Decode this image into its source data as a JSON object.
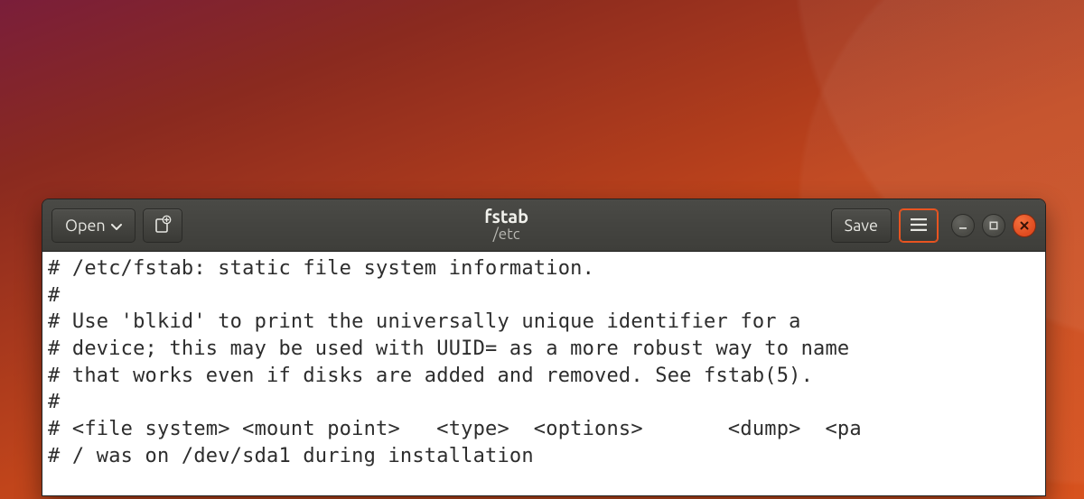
{
  "header": {
    "open_label": "Open",
    "save_label": "Save",
    "title": "fstab",
    "subtitle": "/etc"
  },
  "editor": {
    "lines": [
      "# /etc/fstab: static file system information.",
      "#",
      "# Use 'blkid' to print the universally unique identifier for a",
      "# device; this may be used with UUID= as a more robust way to name",
      "# that works even if disks are added and removed. See fstab(5).",
      "#",
      "# <file system> <mount point>   <type>  <options>       <dump>  <pa",
      "# / was on /dev/sda1 during installation"
    ]
  }
}
